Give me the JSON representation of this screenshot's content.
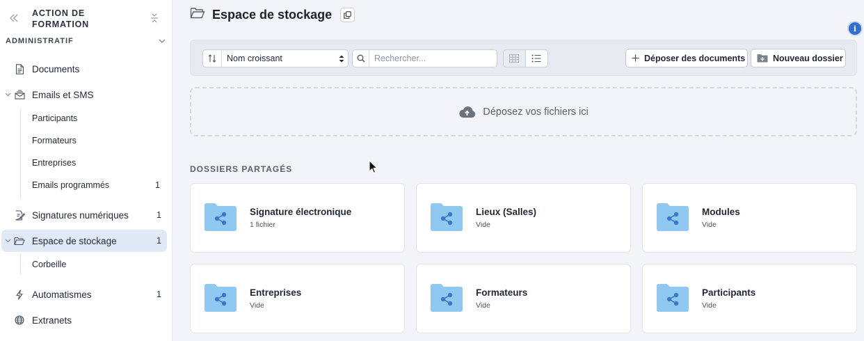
{
  "sidebar": {
    "org_title": "ACTION DE FORMATION",
    "section_label": "ADMINISTRATIF",
    "items": {
      "documents": {
        "label": "Documents"
      },
      "emails": {
        "label": "Emails et SMS"
      },
      "participants": {
        "label": "Participants"
      },
      "formateurs": {
        "label": "Formateurs"
      },
      "entreprises": {
        "label": "Entreprises"
      },
      "emails_programmes": {
        "label": "Emails programmés",
        "count": "1"
      },
      "signatures": {
        "label": "Signatures numériques",
        "count": "1"
      },
      "stockage": {
        "label": "Espace de stockage",
        "count": "1"
      },
      "corbeille": {
        "label": "Corbeille"
      },
      "automatismes": {
        "label": "Automatismes",
        "count": "1"
      },
      "extranets": {
        "label": "Extranets"
      }
    }
  },
  "header": {
    "title": "Espace de stockage"
  },
  "toolbar": {
    "sort_value": "Nom croissant",
    "search_placeholder": "Rechercher...",
    "upload_label": "Déposer des documents",
    "new_folder_label": "Nouveau dossier"
  },
  "dropzone": {
    "text": "Déposez vos fichiers ici"
  },
  "shared": {
    "label": "DOSSIERS PARTAGÉS",
    "folders": [
      {
        "title": "Signature électronique",
        "subtitle": "1 fichier"
      },
      {
        "title": "Lieux (Salles)",
        "subtitle": "Vide"
      },
      {
        "title": "Modules",
        "subtitle": "Vide"
      },
      {
        "title": "Entreprises",
        "subtitle": "Vide"
      },
      {
        "title": "Formateurs",
        "subtitle": "Vide"
      },
      {
        "title": "Participants",
        "subtitle": "Vide"
      }
    ]
  },
  "colors": {
    "accent": "#2f6fcf",
    "folder": "#8fc9f2",
    "active_bg": "#e2e9f6"
  }
}
